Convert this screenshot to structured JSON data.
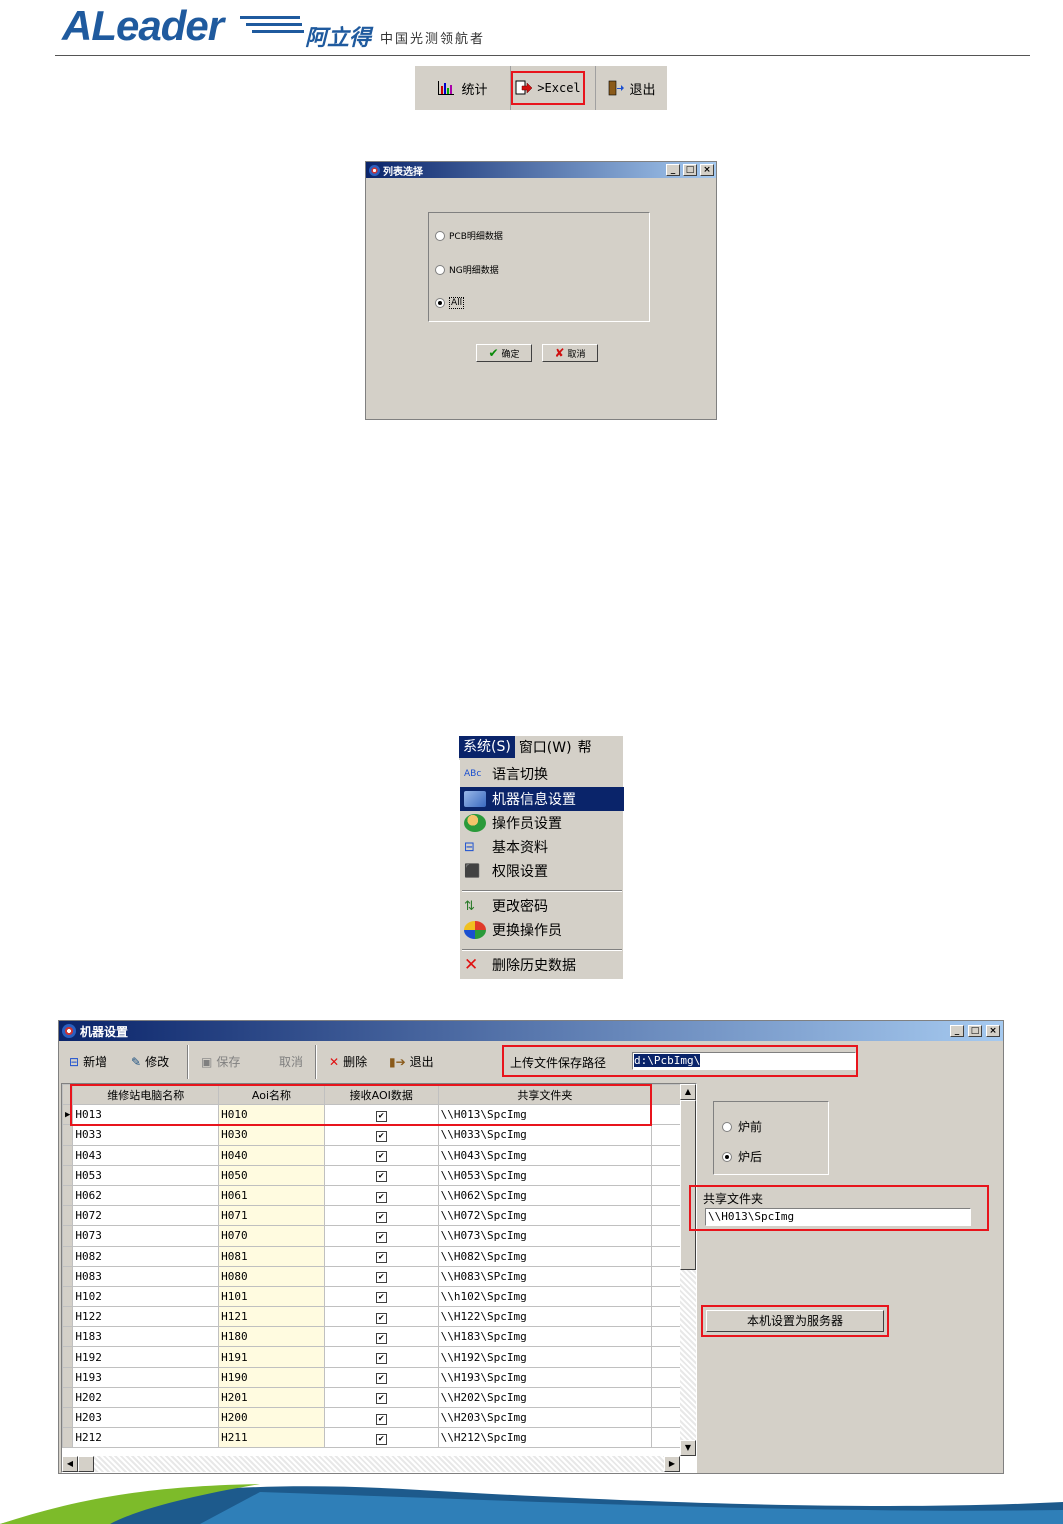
{
  "header": {
    "logo_text": "ALeader",
    "brand_cn": "阿立得",
    "slogan": "中国光测领航者"
  },
  "toolbar1": {
    "stat_label": "统计",
    "excel_label": ">Excel",
    "exit_label": "退出"
  },
  "list_dialog": {
    "title": "列表选择",
    "options": [
      "PCB明细数据",
      "NG明细数据",
      "All"
    ],
    "selected": "All",
    "ok_label": "确定",
    "cancel_label": "取消"
  },
  "menu": {
    "bar": [
      "系统(S)",
      "窗口(W)",
      "帮"
    ],
    "items": [
      "语言切换",
      "机器信息设置",
      "操作员设置",
      "基本资料",
      "权限设置",
      "更改密码",
      "更换操作员",
      "删除历史数据"
    ],
    "highlighted": "机器信息设置"
  },
  "machine_window": {
    "title": "机器设置",
    "toolbar": {
      "add": "新增",
      "edit": "修改",
      "save": "保存",
      "cancel": "取消",
      "delete": "删除",
      "exit": "退出"
    },
    "upload_path_label": "上传文件保存路径",
    "upload_path_value": "d:\\PcbImg\\",
    "columns": [
      "维修站电脑名称",
      "Aoi名称",
      "接收AOI数据",
      "共享文件夹"
    ],
    "rows": [
      [
        "H013",
        "H010",
        "\\\\H013\\SpcImg"
      ],
      [
        "H033",
        "H030",
        "\\\\H033\\SpcImg"
      ],
      [
        "H043",
        "H040",
        "\\\\H043\\SpcImg"
      ],
      [
        "H053",
        "H050",
        "\\\\H053\\SpcImg"
      ],
      [
        "H062",
        "H061",
        "\\\\H062\\SpcImg"
      ],
      [
        "H072",
        "H071",
        "\\\\H072\\SpcImg"
      ],
      [
        "H073",
        "H070",
        "\\\\H073\\SpcImg"
      ],
      [
        "H082",
        "H081",
        "\\\\H082\\SpcImg"
      ],
      [
        "H083",
        "H080",
        "\\\\H083\\SPcImg"
      ],
      [
        "H102",
        "H101",
        "\\\\h102\\SpcImg"
      ],
      [
        "H122",
        "H121",
        "\\\\H122\\SpcImg"
      ],
      [
        "H183",
        "H180",
        "\\\\H183\\SpcImg"
      ],
      [
        "H192",
        "H191",
        "\\\\H192\\SpcImg"
      ],
      [
        "H193",
        "H190",
        "\\\\H193\\SpcImg"
      ],
      [
        "H202",
        "H201",
        "\\\\H202\\SpcImg"
      ],
      [
        "H203",
        "H200",
        "\\\\H203\\SpcImg"
      ],
      [
        "H212",
        "H211",
        "\\\\H212\\SpcImg"
      ]
    ],
    "furnace_options": [
      "炉前",
      "炉后"
    ],
    "furnace_selected": "炉后",
    "share_label": "共享文件夹",
    "share_value": "\\\\H013\\SpcImg",
    "server_button": "本机设置为服务器"
  },
  "colors": {
    "highlight_red": "#e8141c",
    "win_gray": "#d4d0c8",
    "title_blue": "#0a246a",
    "aoi_col_bg": "#fffbe0"
  }
}
